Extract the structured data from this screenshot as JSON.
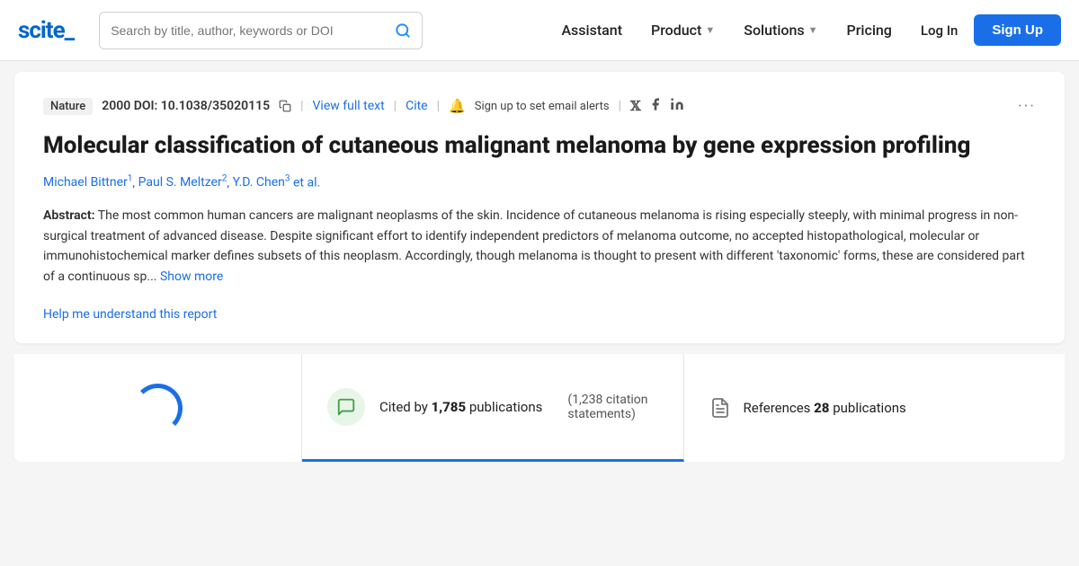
{
  "logo": {
    "text": "scite_"
  },
  "search": {
    "placeholder": "Search by title, author, keywords or DOI"
  },
  "nav": {
    "assistant": "Assistant",
    "product": "Product",
    "solutions": "Solutions",
    "pricing": "Pricing",
    "login": "Log In",
    "signup": "Sign Up"
  },
  "paper": {
    "journal": "Nature",
    "year": "2000",
    "doi": "DOI: 10.1038/35020115",
    "view_full_text": "View full text",
    "cite": "Cite",
    "alert": "Sign up to set email alerts",
    "title": "Molecular classification of cutaneous malignant melanoma by gene expression profiling",
    "authors": [
      {
        "name": "Michael Bittner",
        "sup": "1"
      },
      {
        "name": "Paul S. Meltzer",
        "sup": "2"
      },
      {
        "name": "Y.D. Chen",
        "sup": "3"
      }
    ],
    "et_al": "et al.",
    "abstract_label": "Abstract:",
    "abstract_text": "The most common human cancers are malignant neoplasms of the skin. Incidence of cutaneous melanoma is rising especially steeply, with minimal progress in non-surgical treatment of advanced disease. Despite significant effort to identify independent predictors of melanoma outcome, no accepted histopathological, molecular or immunohistochemical marker defines subsets of this neoplasm. Accordingly, though melanoma is thought to present with different 'taxonomic' forms, these are considered part of a continuous sp...",
    "show_more": "Show more",
    "help_link": "Help me understand this report"
  },
  "citations": {
    "cited_by_label": "Cited by",
    "count": "1,785",
    "publications": "publications",
    "statements_count": "1,238 citation",
    "statements_label": "statements)"
  },
  "references": {
    "label": "References",
    "count": "28",
    "publications": "publications"
  },
  "icons": {
    "search": "🔍",
    "bell": "🔔",
    "twitter": "𝕏",
    "facebook": "f",
    "linkedin": "in",
    "more": "···",
    "chat": "💬",
    "document": "📄"
  }
}
